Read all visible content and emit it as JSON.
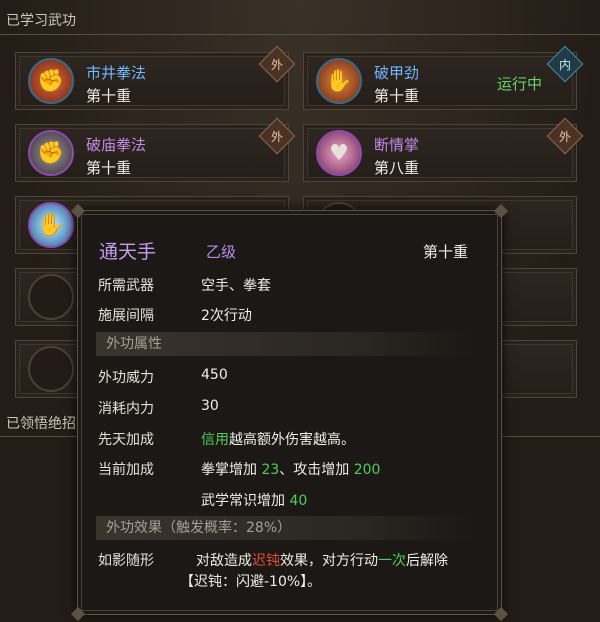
{
  "sections": {
    "learned_title": "已学习武功",
    "enlightened_title": "已领悟绝招"
  },
  "badges": {
    "outer": "外",
    "inner": "内"
  },
  "skills": [
    {
      "name": "市井拳法",
      "level": "第十重",
      "name_color": "#6fb6ff",
      "icon": "fist-burst-icon"
    },
    {
      "name": "破甲劲",
      "level": "第十重",
      "name_color": "#6fb6ff",
      "icon": "paw-icon",
      "status": "运行中"
    },
    {
      "name": "破庙拳法",
      "level": "第十重",
      "name_color": "#c58ae8",
      "icon": "gauntlet-icon"
    },
    {
      "name": "断情掌",
      "level": "第八重",
      "name_color": "#c58ae8",
      "icon": "broken-heart-icon"
    },
    {
      "name": "通天手",
      "level": "第十重",
      "name_color": "#c58ae8",
      "icon": "glowing-hand-icon"
    }
  ],
  "tooltip": {
    "title": "通天手",
    "grade": "乙级",
    "level": "第十重",
    "weapon_label": "所需武器",
    "weapon_value": "空手、拳套",
    "interval_label": "施展间隔",
    "interval_value": "2次行动",
    "outer_attr_band": "外功属性",
    "power_label": "外功威力",
    "power_value": "450",
    "cost_label": "消耗内力",
    "cost_value": "30",
    "innate_label": "先天加成",
    "innate_highlight": "信用",
    "innate_text": "越高额外伤害越高。",
    "current_label": "当前加成",
    "bonus1_text": "拳掌增加",
    "bonus1_value": "23",
    "bonus_sep": "、攻击增加",
    "bonus2_value": "200",
    "bonus3_text": "武学常识增加",
    "bonus3_value": "40",
    "effect_band": "外功效果（触发概率：28%）",
    "effect_label": "如影随形",
    "effect_text_a": "对敌造成",
    "effect_red": "迟钝",
    "effect_text_b": "效果，对方行动",
    "effect_green": "一次",
    "effect_text_c": "后解除",
    "effect_line2": "【迟钝：闪避-10%】。"
  },
  "colors": {
    "running": "#5fd66a",
    "purple_title": "#c79cf0",
    "blue_name": "#6fb6ff"
  }
}
